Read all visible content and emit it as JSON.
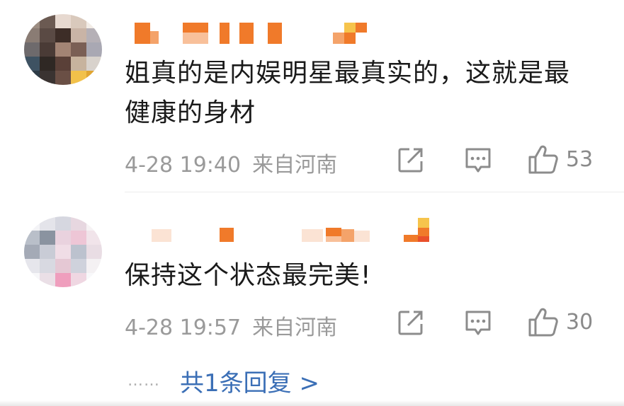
{
  "comments": [
    {
      "text_line1": "姐真的是内娱明星最真实的，这就是最",
      "text_line2": "健康的身材",
      "time": "4-28 19:40",
      "source": "来自河南",
      "like_count": "53"
    },
    {
      "text_line1": "保持这个状态最完美!",
      "time": "4-28 19:57",
      "source": "来自河南",
      "like_count": "30"
    }
  ],
  "replies": {
    "dots": "……",
    "link": "共1条回复 >"
  },
  "colors": {
    "text": "#1a1a1a",
    "meta": "#9a9a9a",
    "link": "#3b6fb6",
    "username_orange": "#f07a2a"
  },
  "icons": {
    "share": "share-icon",
    "comment": "comment-icon",
    "like": "thumbs-up-icon"
  }
}
